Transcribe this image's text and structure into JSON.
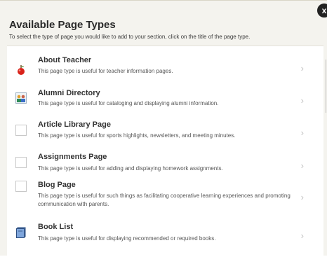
{
  "dialog": {
    "title": "Available Page Types",
    "subtitle": "To select the type of page you would like to add to your section, click on the title of the page type.",
    "close_label": "x"
  },
  "page_types": [
    {
      "title": "About Teacher",
      "description": "This page type is useful for teacher information pages.",
      "icon": "apple-icon"
    },
    {
      "title": "Alumni Directory",
      "description": "This page type is useful for cataloging and displaying alumni information.",
      "icon": "people-icon"
    },
    {
      "title": "Article Library Page",
      "description": "This page type is useful for sports highlights, newsletters, and meeting minutes.",
      "icon": "blank-page-icon"
    },
    {
      "title": "Assignments Page",
      "description": "This page type is useful for adding and displaying homework assignments.",
      "icon": "blank-page-icon"
    },
    {
      "title": "Blog Page",
      "description": "This page type is useful for such things as facilitating cooperative learning experiences and promoting communication with parents.",
      "icon": "blank-page-icon"
    },
    {
      "title": "Book List",
      "description": "This page type is useful for displaying recommended or required books.",
      "icon": "book-icon"
    }
  ],
  "chevron": "›"
}
